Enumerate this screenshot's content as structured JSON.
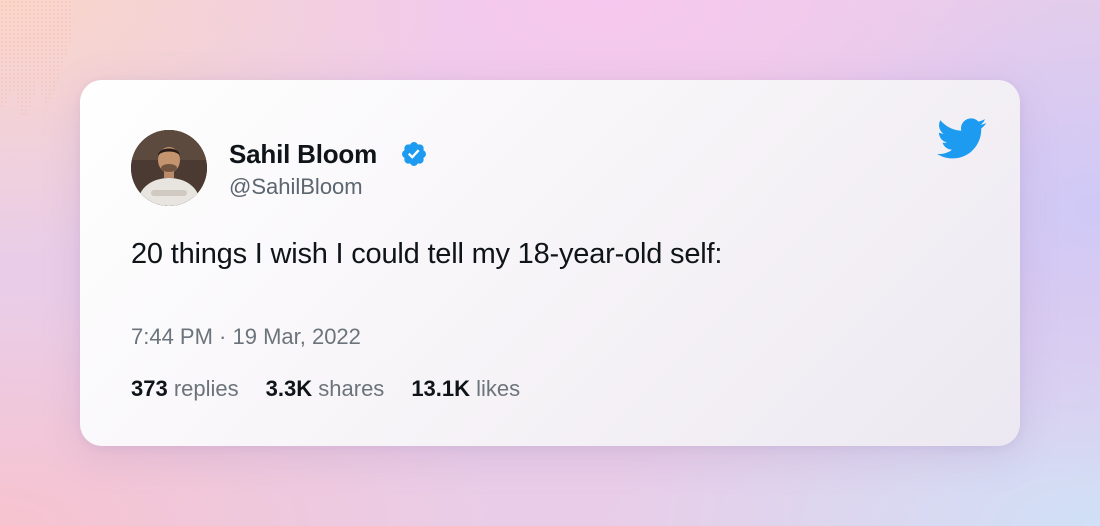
{
  "author": {
    "name": "Sahil Bloom",
    "handle": "@SahilBloom",
    "verified": true
  },
  "tweet": {
    "text": "20 things I wish I could tell my 18-year-old self:",
    "time": "7:44 PM",
    "date": "19 Mar, 2022",
    "timestamp": "7:44 PM · 19 Mar, 2022"
  },
  "stats": [
    {
      "count": "373",
      "label": "replies"
    },
    {
      "count": "3.3K",
      "label": "shares"
    },
    {
      "count": "13.1K",
      "label": "likes"
    }
  ],
  "icons": {
    "verified": "verified-badge-icon",
    "brand": "twitter-bird-icon"
  },
  "colors": {
    "twitter_blue": "#1d9bf0",
    "text_primary": "#0f1419",
    "text_secondary": "#6b747c"
  }
}
